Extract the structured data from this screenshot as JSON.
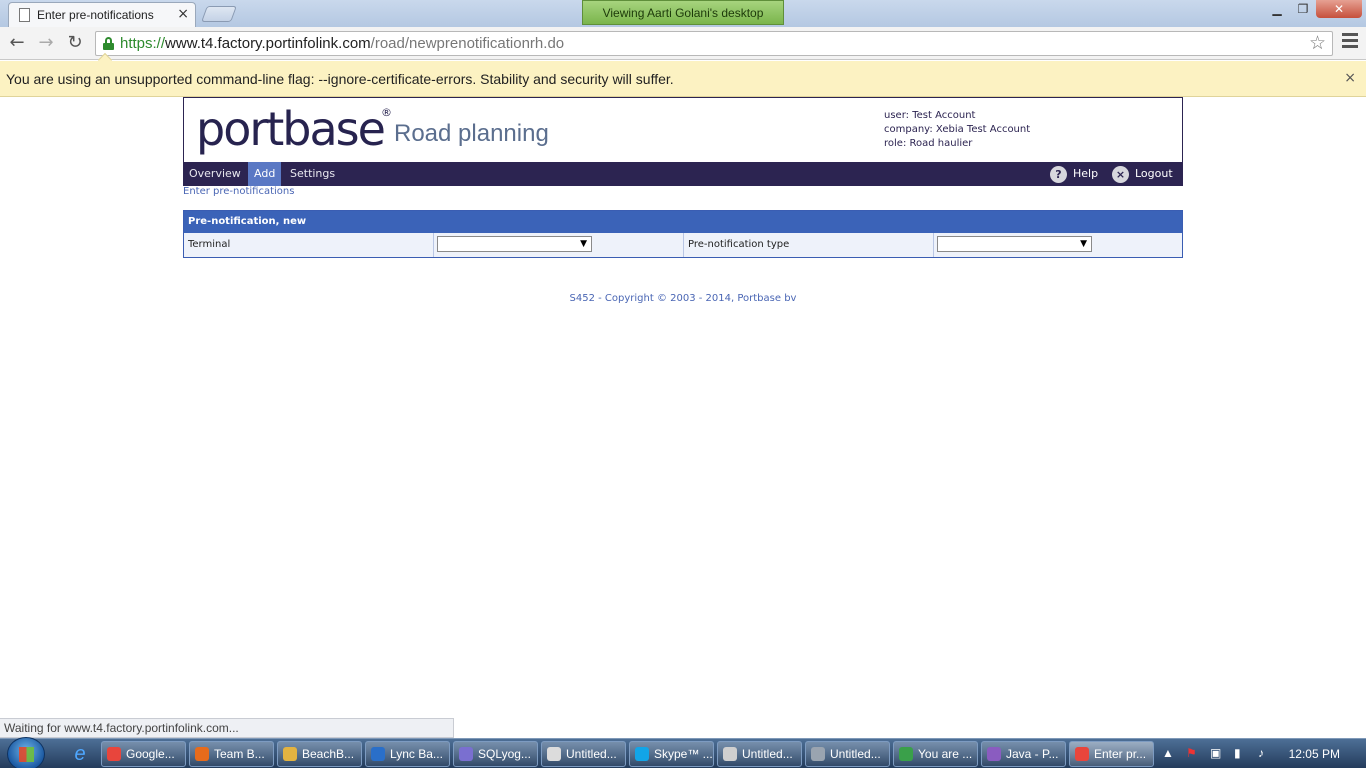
{
  "browser": {
    "tab_title": "Enter pre-notifications",
    "tab_close": "×",
    "remote_banner": "Viewing Aarti Golani's desktop",
    "url_scheme": "https://",
    "url_host": "www.t4.factory.portinfolink.com",
    "url_path": "/road/newprenotificationrh.do",
    "infobar_message": "You are using an unsupported command-line flag: --ignore-certificate-errors. Stability and security will suffer.",
    "infobar_close": "×",
    "status_text": "Waiting for www.t4.factory.portinfolink.com...",
    "back_glyph": "←",
    "forward_glyph": "→",
    "reload_glyph": "↻",
    "star_glyph": "☆"
  },
  "header": {
    "logo_text": "portbase",
    "logo_mark": "®",
    "subtitle": "Road planning",
    "user_label": "user:",
    "user_value": "Test Account",
    "company_label": "company:",
    "company_value": "Xebia Test Account",
    "role_label": "role:",
    "role_value": "Road haulier"
  },
  "nav": {
    "overview": "Overview",
    "add": "Add",
    "settings": "Settings",
    "help": "Help",
    "logout": "Logout",
    "help_glyph": "?",
    "logout_glyph": "×"
  },
  "breadcrumb": "Enter pre-notifications",
  "form": {
    "panel_title": "Pre-notification, new",
    "terminal_label": "Terminal",
    "terminal_value": "",
    "type_label": "Pre-notification type",
    "type_value": ""
  },
  "footer": "S452 - Copyright © 2003 - 2014, Portbase bv",
  "taskbar": {
    "items": [
      {
        "label": "Google...",
        "color": "#e8453c"
      },
      {
        "label": "Team B...",
        "color": "#e66b1c"
      },
      {
        "label": "BeachB...",
        "color": "#e3b341"
      },
      {
        "label": "Lync Ba...",
        "color": "#2a6fc9"
      },
      {
        "label": "SQLyog...",
        "color": "#7a6fd0"
      },
      {
        "label": "Untitled...",
        "color": "#dcdcdc"
      },
      {
        "label": "Skype™ ...",
        "color": "#12a5e8"
      },
      {
        "label": "Untitled...",
        "color": "#cfcfcf"
      },
      {
        "label": "Untitled...",
        "color": "#9aa4b0"
      },
      {
        "label": "You are ...",
        "color": "#3aa04a"
      },
      {
        "label": "Java - P...",
        "color": "#8a5cc0"
      },
      {
        "label": "Enter pr...",
        "color": "#e8453c"
      }
    ],
    "clock": "12:05 PM",
    "ie_glyph": "e"
  },
  "colors": {
    "brand_dark": "#2c2451",
    "accent_blue": "#3b63b8",
    "link_blue": "#4a66b4",
    "infobar_bg": "#fcf2c2"
  }
}
